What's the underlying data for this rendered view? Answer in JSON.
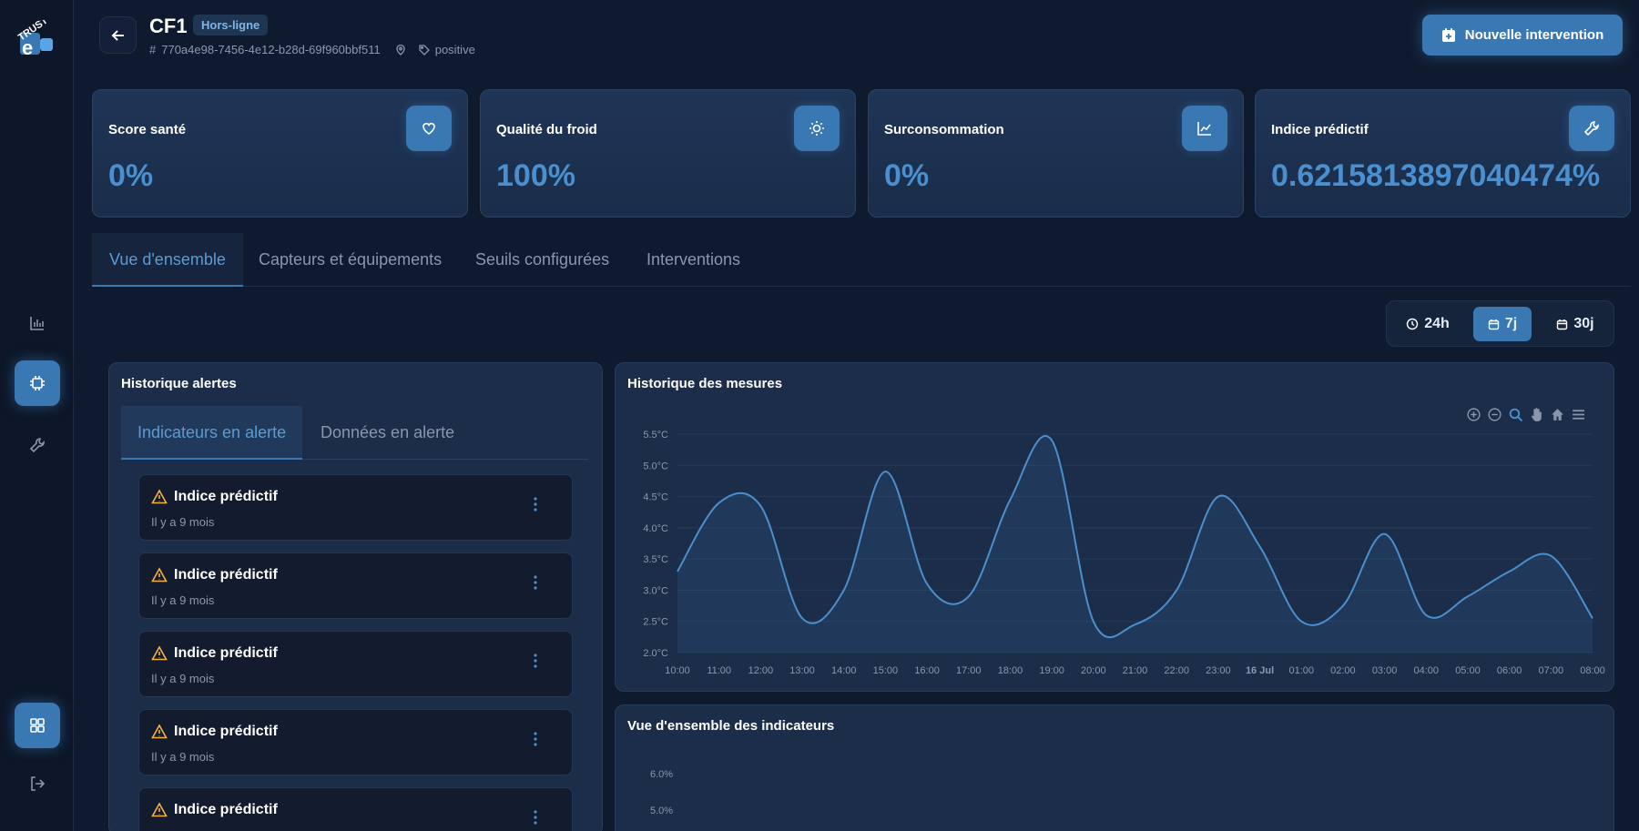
{
  "header": {
    "title": "CF1",
    "status_badge": "Hors-ligne",
    "device_id": "770a4e98-7456-4e12-b28d-69f960bbf511",
    "tag": "positive",
    "new_intervention_label": "Nouvelle intervention"
  },
  "kpis": [
    {
      "label": "Score santé",
      "value": "0%",
      "icon": "heart-icon"
    },
    {
      "label": "Qualité du froid",
      "value": "100%",
      "icon": "sun-icon"
    },
    {
      "label": "Surconsommation",
      "value": "0%",
      "icon": "chart-icon"
    },
    {
      "label": "Indice prédictif",
      "value": "0.6215813897040474%",
      "icon": "wrench-icon"
    }
  ],
  "tabs": [
    "Vue d'ensemble",
    "Capteurs et équipements",
    "Seuils configurées",
    "Interventions"
  ],
  "range": {
    "options": [
      "24h",
      "7j",
      "30j"
    ],
    "selected": "7j"
  },
  "alerts_panel": {
    "title": "Historique alertes",
    "subtabs": [
      "Indicateurs en alerte",
      "Données en alerte"
    ],
    "items": [
      {
        "title": "Indice prédictif",
        "time": "Il y a 9 mois"
      },
      {
        "title": "Indice prédictif",
        "time": "Il y a 9 mois"
      },
      {
        "title": "Indice prédictif",
        "time": "Il y a 9 mois"
      },
      {
        "title": "Indice prédictif",
        "time": "Il y a 9 mois"
      },
      {
        "title": "Indice prédictif",
        "time": ""
      }
    ]
  },
  "measures_panel": {
    "title": "Historique des mesures"
  },
  "overview_panel": {
    "title": "Vue d'ensemble des indicateurs",
    "y_ticks": [
      "6.0%",
      "5.0%"
    ]
  },
  "colors": {
    "accent": "#3a78b4",
    "line": "#4a8fcf",
    "background": "#0f1a2e"
  },
  "chart_data": {
    "type": "area",
    "x": [
      "10:00",
      "11:00",
      "12:00",
      "13:00",
      "14:00",
      "15:00",
      "16:00",
      "17:00",
      "18:00",
      "19:00",
      "20:00",
      "21:00",
      "22:00",
      "23:00",
      "16 Jul",
      "01:00",
      "02:00",
      "03:00",
      "04:00",
      "05:00",
      "06:00",
      "07:00",
      "08:00"
    ],
    "series": [
      {
        "values": [
          3.3,
          4.4,
          4.35,
          2.55,
          3.0,
          4.9,
          3.1,
          2.9,
          4.45,
          5.4,
          2.5,
          2.45,
          3.0,
          4.5,
          3.7,
          2.5,
          2.75,
          3.9,
          2.6,
          2.9,
          3.3,
          3.55,
          2.55
        ]
      }
    ],
    "y_ticks": [
      "5.5°C",
      "5.0°C",
      "4.5°C",
      "4.0°C",
      "3.5°C",
      "3.0°C",
      "2.5°C",
      "2.0°C"
    ],
    "ylim": [
      2.0,
      5.5
    ],
    "grid": true
  }
}
